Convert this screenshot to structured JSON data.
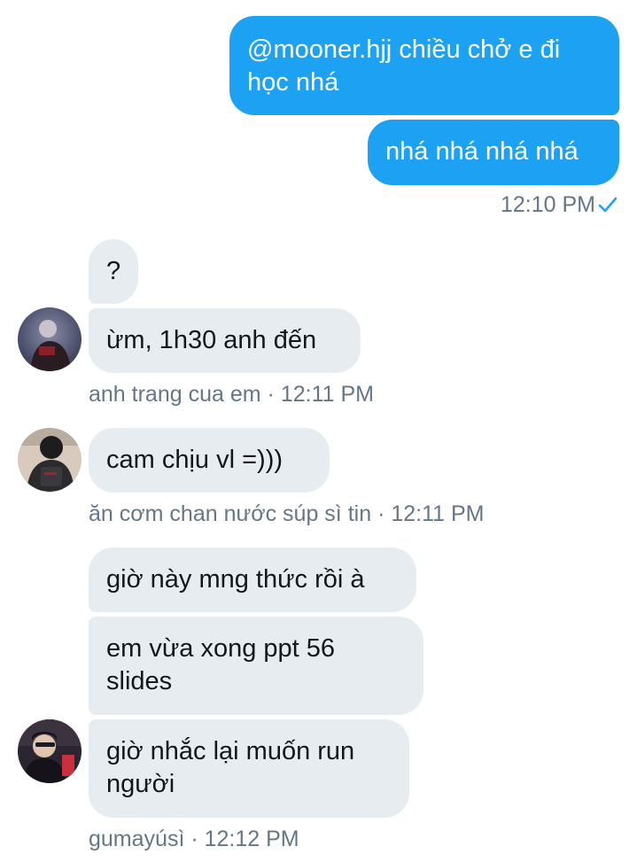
{
  "conversation": {
    "sent": {
      "messages": [
        "@mooner.hjj chiều chở e đi học nhá",
        "nhá nhá nhá nhá"
      ],
      "time": "12:10 PM",
      "status_icon": "checkmark-icon"
    },
    "groups": [
      {
        "messages": [
          "?",
          "ừm, 1h30 anh đến"
        ],
        "sender": "anh trang cua em",
        "separator": "·",
        "time": "12:11 PM"
      },
      {
        "messages": [
          "cam chịu vl =)))"
        ],
        "sender": "ăn cơm chan nước súp sì tin",
        "separator": "·",
        "time": "12:11 PM"
      },
      {
        "messages": [
          "giờ này mng thức rồi à",
          "em vừa xong ppt 56 slides",
          "giờ nhắc lại muốn run người"
        ],
        "sender": "gumayúsì",
        "separator": "·",
        "time": "12:12 PM"
      }
    ]
  },
  "colors": {
    "outgoing_bubble": "#1da1f2",
    "incoming_bubble": "#e6ecf0",
    "meta_text": "#657786"
  }
}
